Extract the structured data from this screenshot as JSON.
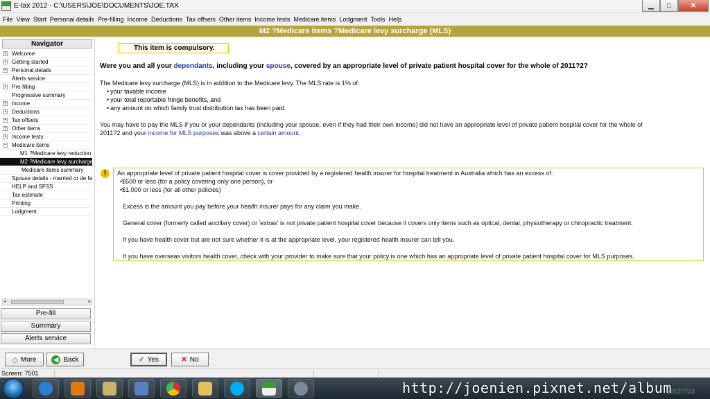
{
  "window": {
    "title": "E-tax 2012 - C:\\USERS\\JOE\\DOCUMENTS\\JOE.TAX"
  },
  "menu": [
    "File",
    "View",
    "Start",
    "Personal details",
    "Pre-filling",
    "Income",
    "Deductions",
    "Tax offsets",
    "Other items",
    "Income tests",
    "Medicare items",
    "Lodgment",
    "Tools",
    "Help"
  ],
  "header": {
    "title": "M2 ?Medicare items ?Medicare levy surcharge (MLS)"
  },
  "navigator": {
    "title": "Navigator",
    "items": [
      {
        "label": "Welcome",
        "expander": "+",
        "level": 0
      },
      {
        "label": "Getting started",
        "expander": "+",
        "level": 0
      },
      {
        "label": "Personal details",
        "expander": "+",
        "level": 0
      },
      {
        "label": "Alerts service",
        "expander": "",
        "level": 0
      },
      {
        "label": "Pre-filling",
        "expander": "+",
        "level": 0
      },
      {
        "label": "Progressive summary",
        "expander": "",
        "level": 0
      },
      {
        "label": "Income",
        "expander": "+",
        "level": 0
      },
      {
        "label": "Deductions",
        "expander": "+",
        "level": 0
      },
      {
        "label": "Tax offsets",
        "expander": "+",
        "level": 0
      },
      {
        "label": "Other items",
        "expander": "+",
        "level": 0
      },
      {
        "label": "Income tests",
        "expander": "+",
        "level": 0
      },
      {
        "label": "Medicare items",
        "expander": "−",
        "level": 0
      },
      {
        "label": "M1 ?Medicare levy reduction",
        "expander": "",
        "level": 1
      },
      {
        "label": "M2 ?Medicare levy surcharge",
        "expander": "",
        "level": 1,
        "selected": true
      },
      {
        "label": "Medicare items summary",
        "expander": "",
        "level": 2
      },
      {
        "label": "Spouse details - married or de facto",
        "expander": "",
        "level": 0
      },
      {
        "label": "HELP and SFSS",
        "expander": "",
        "level": 0
      },
      {
        "label": "Tax estimate",
        "expander": "",
        "level": 0
      },
      {
        "label": "Printing",
        "expander": "",
        "level": 0
      },
      {
        "label": "Lodgment",
        "expander": "",
        "level": 0
      }
    ],
    "buttons": {
      "prefill": "Pre-fill",
      "summary": "Summary",
      "alerts": "Alerts service"
    }
  },
  "content": {
    "compulsory": "This item is compulsory.",
    "question": {
      "part1": "Were you and all your ",
      "link1": "dependants",
      "part2": ", including your ",
      "link2": "spouse",
      "part3": ", covered by an appropriate level of private patient hospital cover for the whole of 2011?2?"
    },
    "intro": "The Medicare levy surcharge (MLS) is in addition to the Medicare levy. The MLS rate is 1% of:",
    "bullets": [
      "your taxable income",
      "your total reportable fringe benefits, and",
      "any amount on which family trust distribution tax has been paid."
    ],
    "mls_para": {
      "line1": "You may have to pay the MLS if you or your dependants (including your spouse, even if they had their own income) did not have an appropriate level of private patient hospital cover for the whole of",
      "part1": "2011?2 and your ",
      "link1": "income for MLS purposes",
      "part2": " was above a ",
      "link2": "certain amount",
      "part3": "."
    },
    "info": {
      "intro": "An appropriate level of private patient hospital cover is cover provided by a registered health insurer for hospital treatment in Australia which has an excess of:",
      "bullets": [
        "$500 or less (for a policy covering only one person), or",
        "$1,000 or less (for all other policies)"
      ],
      "p1": "Excess is the amount you pay before your health insurer pays for any claim you make.",
      "p2": "General cover (formerly called ancillary cover) or 'extras' is not private patient hospital cover because it covers only items such as optical, dental, physiotherapy or chiropractic treatment.",
      "p3": "If you have health cover but are not sure whether it is at the appropriate level, your registered health insurer can tell you.",
      "p4": "If you have overseas visitors health cover, check with your provider to make sure that your policy is one which has an appropriate level of private patient hospital cover for MLS purposes."
    }
  },
  "toolbar": {
    "more": "More",
    "back": "Back",
    "yes": "Yes",
    "no": "No"
  },
  "status": {
    "screen": "Screen: 7501"
  },
  "taskbar": {
    "watermark": "http://joenien.pixnet.net/album",
    "date": "2012/7/23"
  },
  "colors": {
    "header": "#b5a33c",
    "link": "#1a3aa8",
    "warning": "#f0c000",
    "selected": "#101010"
  }
}
